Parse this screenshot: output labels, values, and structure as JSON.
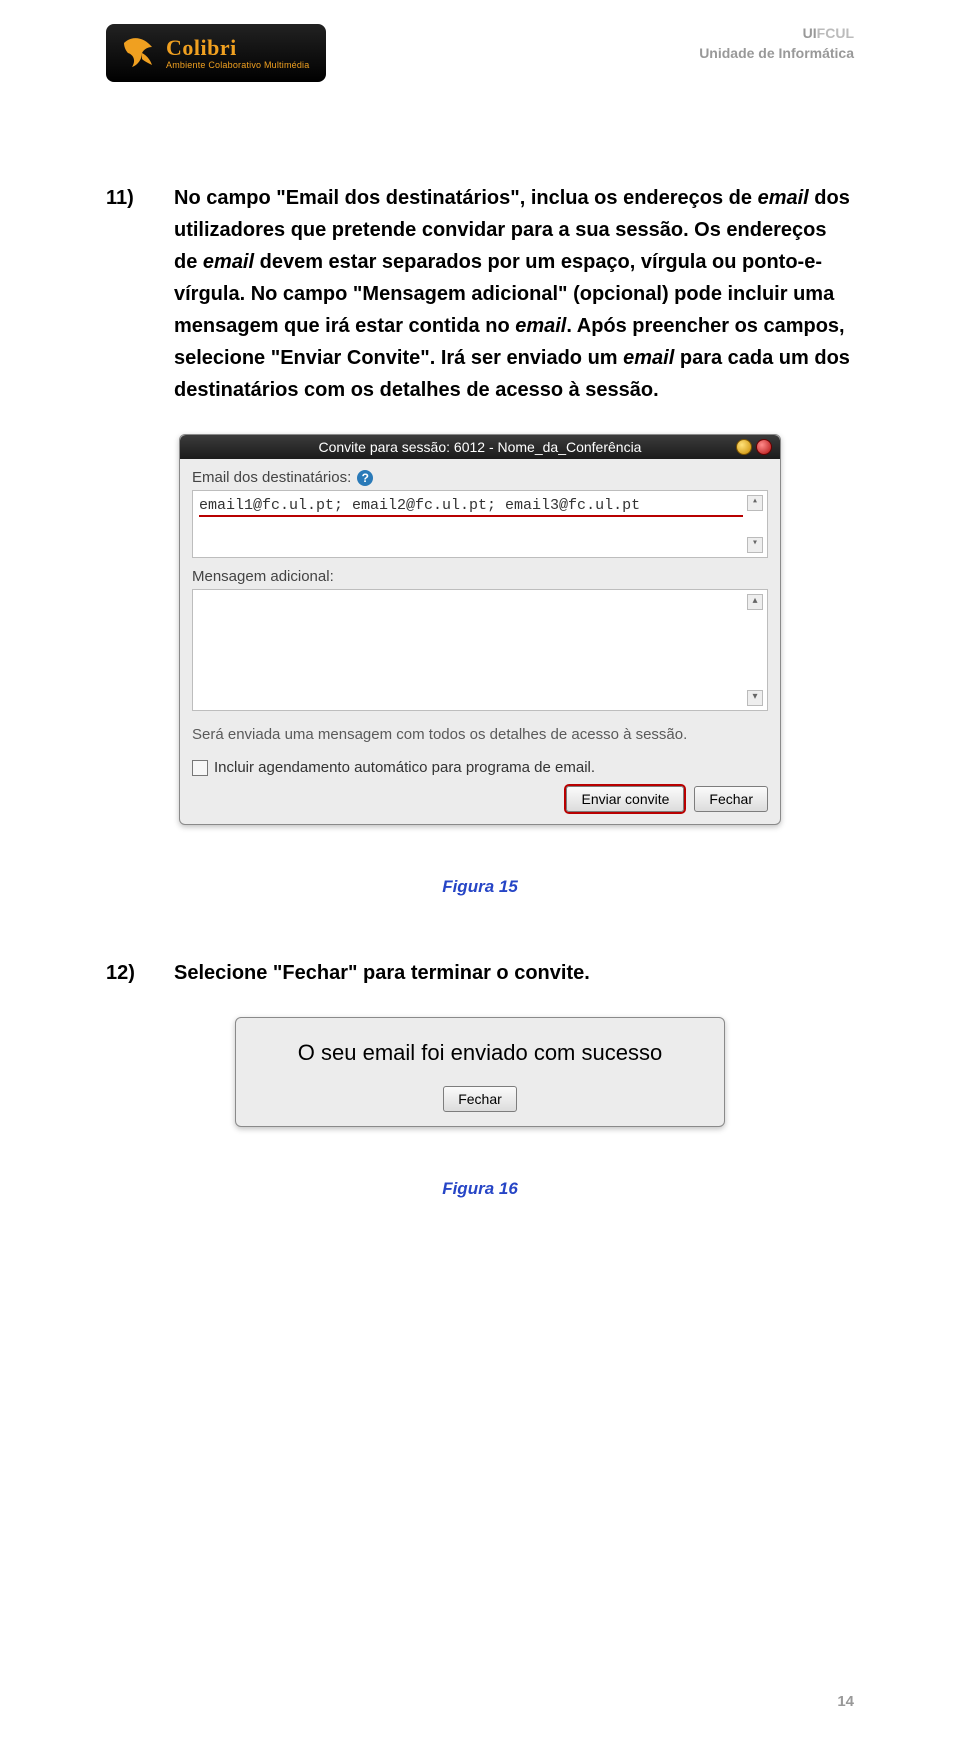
{
  "header": {
    "logo_title": "Colibri",
    "logo_sub": "Ambiente Colaborativo Multimédia",
    "org_line1_a": "UI",
    "org_line1_b": "FCUL",
    "org_line2": "Unidade de Informática"
  },
  "step11": {
    "num": "11)",
    "body_parts": {
      "p1a": "No campo \"Email dos destinatários\", inclua os endereços de ",
      "p1b": "email",
      "p1c": " dos utilizadores que pretende convidar para a sua sessão. Os endereços de ",
      "p1d": "email",
      "p1e": " devem estar separados por um espaço, vírgula ou ponto-e-vírgula. No campo \"Mensagem adicional\" (opcional) pode incluir uma mensagem que irá estar contida no ",
      "p1f": "email",
      "p1g": ". Após preencher os campos, selecione \"Enviar Convite\". Irá ser enviado um ",
      "p1h": "email",
      "p1i": " para cada um dos destinatários com os detalhes de acesso à sessão."
    }
  },
  "invite_panel": {
    "title": "Convite para sessão: 6012 - Nome_da_Conferência",
    "dest_label": "Email dos destinatários:",
    "emails_value": "email1@fc.ul.pt; email2@fc.ul.pt; email3@fc.ul.pt",
    "msg_label": "Mensagem adicional:",
    "note": "Será enviada uma mensagem com todos os detalhes de acesso à sessão.",
    "check_label": "Incluir agendamento automático para programa de email.",
    "btn_send": "Enviar convite",
    "btn_close": "Fechar"
  },
  "caption15": "Figura 15",
  "step12": {
    "num": "12)",
    "body": "Selecione \"Fechar\" para terminar o convite."
  },
  "success_panel": {
    "msg": "O seu email foi enviado com sucesso",
    "btn_close": "Fechar"
  },
  "caption16": "Figura 16",
  "page_number": "14"
}
